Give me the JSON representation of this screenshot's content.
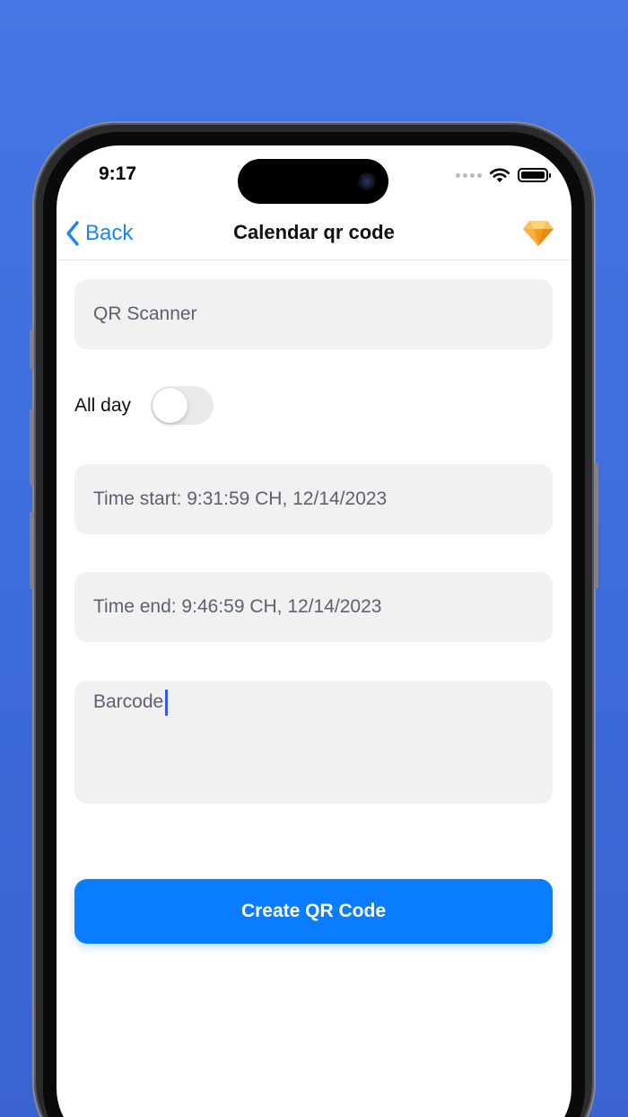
{
  "status_bar": {
    "time": "9:17"
  },
  "nav": {
    "back_label": "Back",
    "title": "Calendar qr code"
  },
  "form": {
    "title_value": "QR Scanner",
    "all_day_label": "All day",
    "all_day_on": false,
    "time_start": "Time start: 9:31:59 CH, 12/14/2023",
    "time_end": "Time end: 9:46:59 CH, 12/14/2023",
    "notes_value": "Barcode"
  },
  "actions": {
    "create_label": "Create QR Code"
  },
  "colors": {
    "background": "#4576e3",
    "accent": "#0a7cff",
    "link": "#1a86f5",
    "field_bg": "#f1f1f2",
    "premium_gem": "#f7a52e"
  },
  "icons": {
    "back": "chevron-left-icon",
    "premium": "diamond-icon",
    "wifi": "wifi-icon",
    "battery": "battery-icon"
  }
}
